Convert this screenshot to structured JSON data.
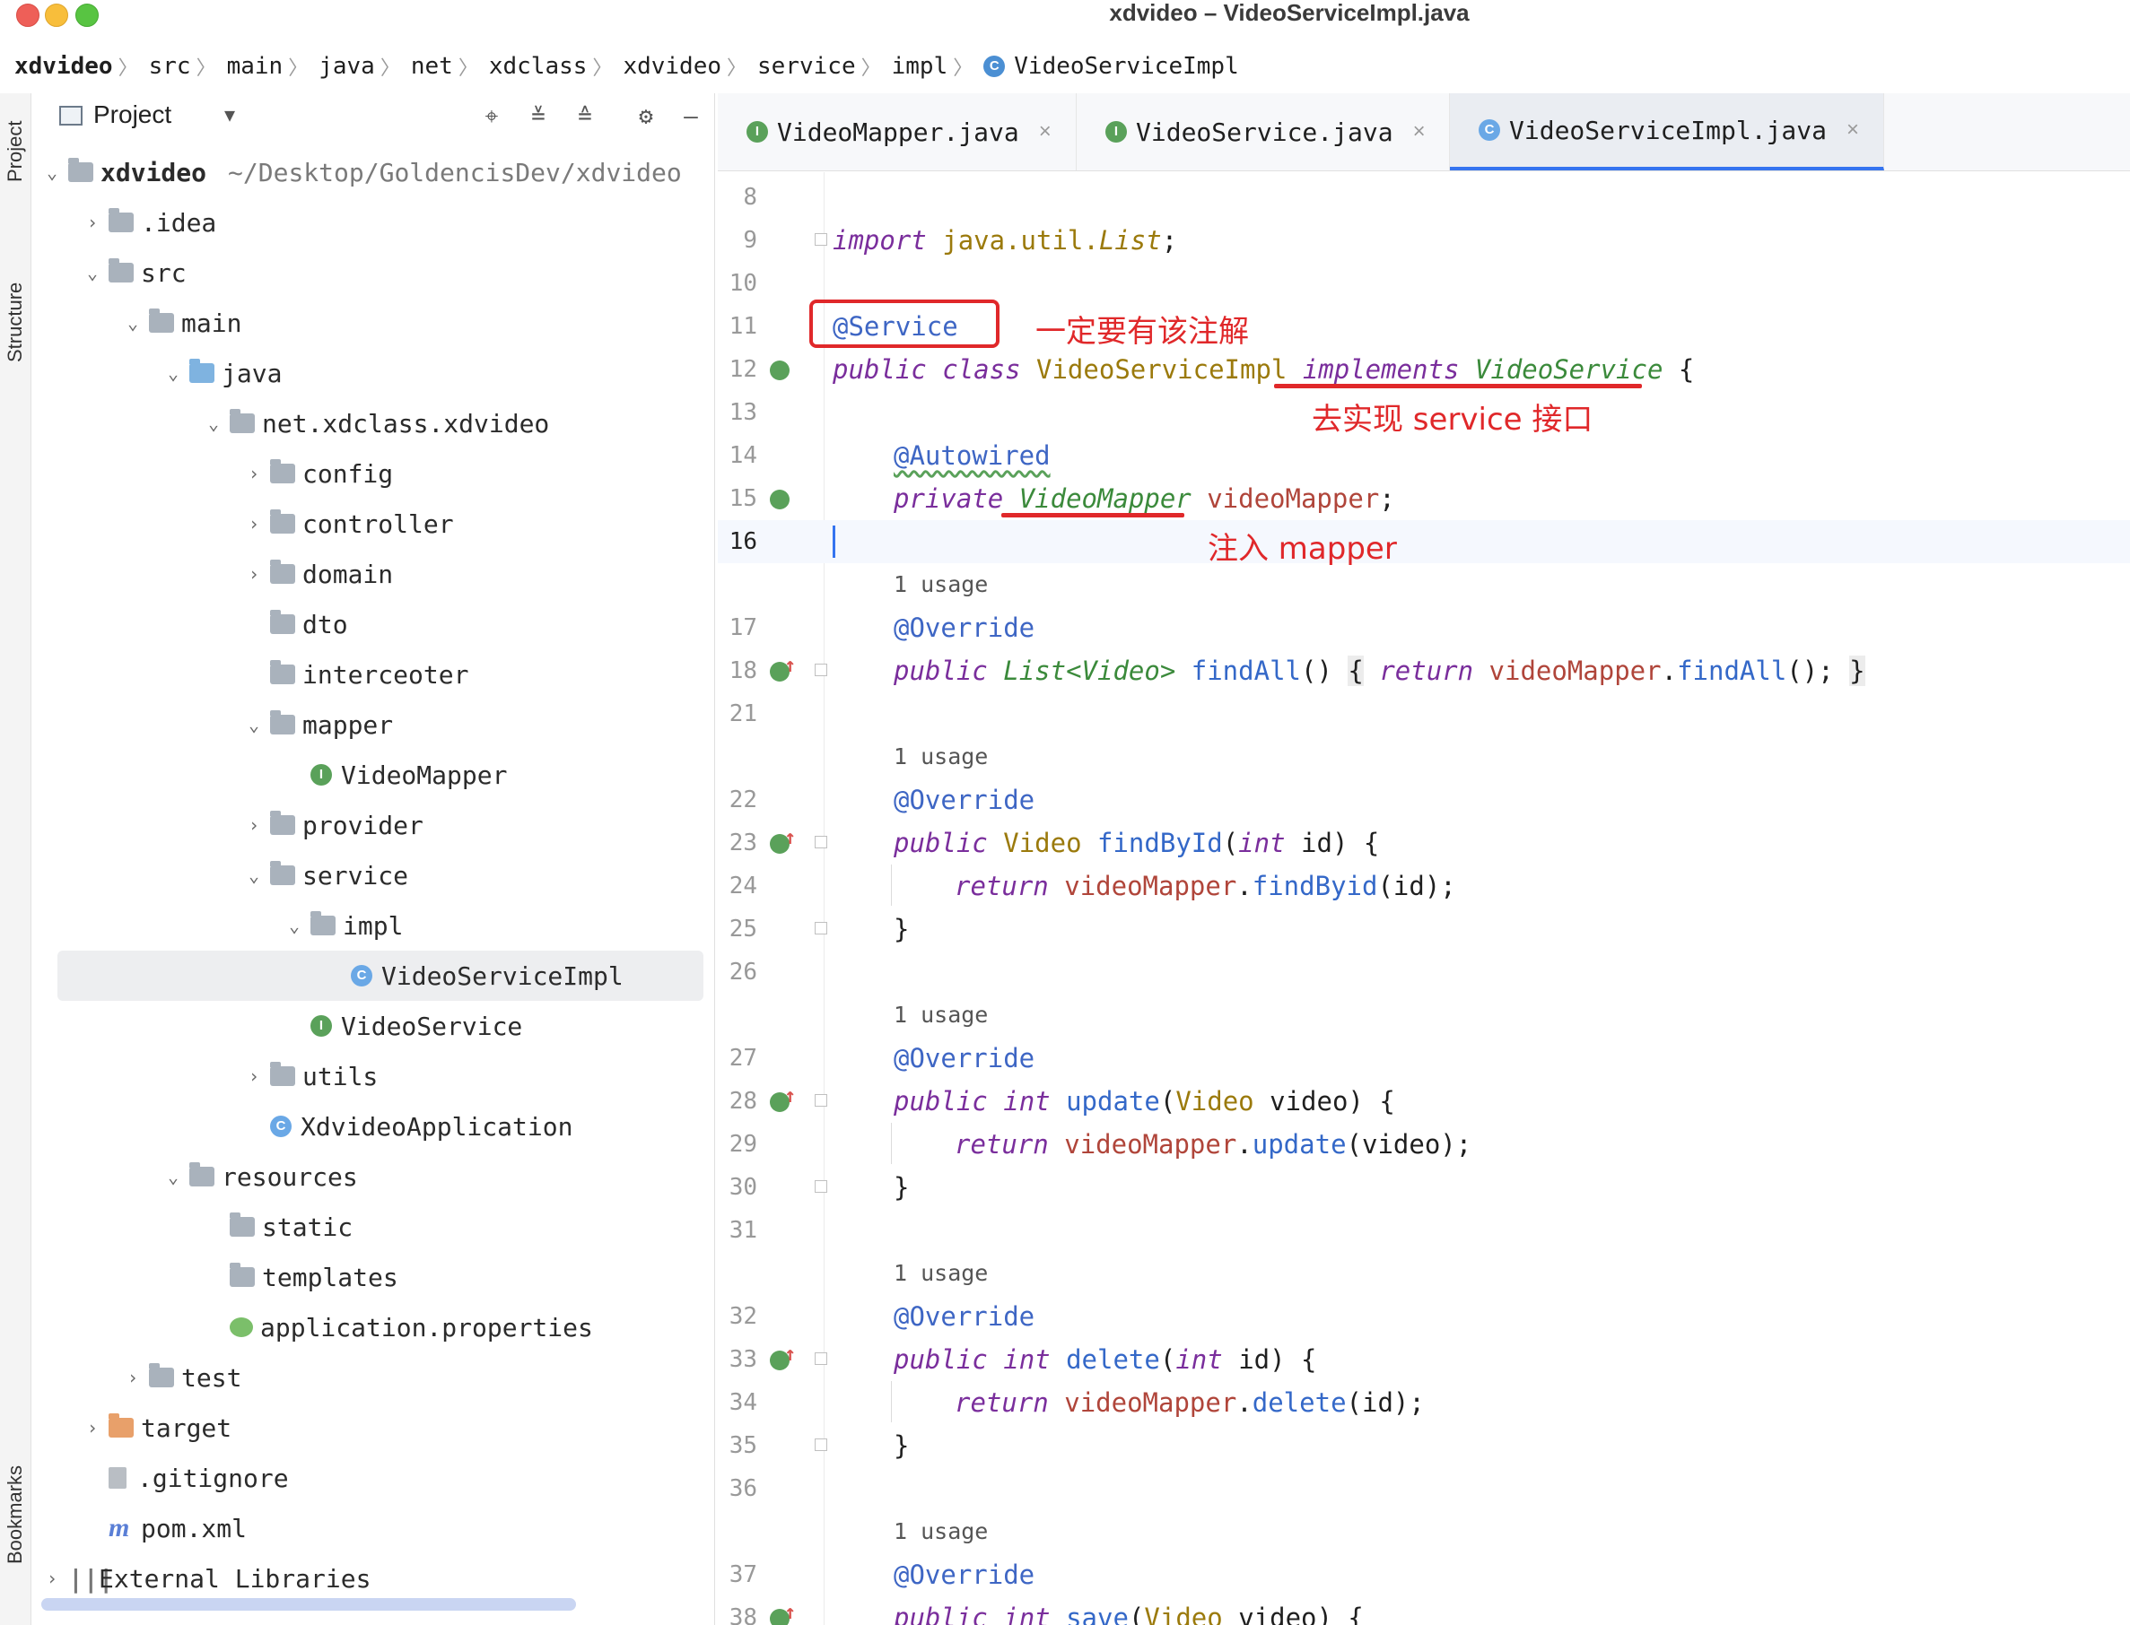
{
  "window": {
    "title": "xdvideo – VideoServiceImpl.java"
  },
  "breadcrumb": [
    "xdvideo",
    "src",
    "main",
    "java",
    "net",
    "xdclass",
    "xdvideo",
    "service",
    "impl",
    "VideoServiceImpl"
  ],
  "toolstrip": {
    "project": "Project",
    "structure": "Structure",
    "bookmarks": "Bookmarks"
  },
  "project_panel": {
    "title": "Project",
    "tree": [
      {
        "label": "xdvideo",
        "suffix": "~/Desktop/GoldencisDev/xdvideo",
        "depth": 0,
        "toggle": "open",
        "icon": "module-folder-icon"
      },
      {
        "label": ".idea",
        "depth": 1,
        "toggle": "closed",
        "icon": "folder-icon"
      },
      {
        "label": "src",
        "depth": 1,
        "toggle": "open",
        "icon": "folder-icon"
      },
      {
        "label": "main",
        "depth": 2,
        "toggle": "open",
        "icon": "folder-icon"
      },
      {
        "label": "java",
        "depth": 3,
        "toggle": "open",
        "icon": "source-folder-icon"
      },
      {
        "label": "net.xdclass.xdvideo",
        "depth": 4,
        "toggle": "open",
        "icon": "package-icon"
      },
      {
        "label": "config",
        "depth": 5,
        "toggle": "closed",
        "icon": "package-icon"
      },
      {
        "label": "controller",
        "depth": 5,
        "toggle": "closed",
        "icon": "package-icon"
      },
      {
        "label": "domain",
        "depth": 5,
        "toggle": "closed",
        "icon": "package-icon"
      },
      {
        "label": "dto",
        "depth": 5,
        "toggle": "none",
        "icon": "package-icon"
      },
      {
        "label": "interceoter",
        "depth": 5,
        "toggle": "none",
        "icon": "package-icon"
      },
      {
        "label": "mapper",
        "depth": 5,
        "toggle": "open",
        "icon": "package-icon"
      },
      {
        "label": "VideoMapper",
        "depth": 6,
        "toggle": "none",
        "icon": "interface-icon"
      },
      {
        "label": "provider",
        "depth": 5,
        "toggle": "closed",
        "icon": "package-icon"
      },
      {
        "label": "service",
        "depth": 5,
        "toggle": "open",
        "icon": "package-icon"
      },
      {
        "label": "impl",
        "depth": 6,
        "toggle": "open",
        "icon": "package-icon"
      },
      {
        "label": "VideoServiceImpl",
        "depth": 7,
        "toggle": "none",
        "icon": "class-icon",
        "selected": true
      },
      {
        "label": "VideoService",
        "depth": 6,
        "toggle": "none",
        "icon": "interface-icon"
      },
      {
        "label": "utils",
        "depth": 5,
        "toggle": "closed",
        "icon": "package-icon"
      },
      {
        "label": "XdvideoApplication",
        "depth": 5,
        "toggle": "none",
        "icon": "spring-class-icon"
      },
      {
        "label": "resources",
        "depth": 3,
        "toggle": "open",
        "icon": "resources-folder-icon"
      },
      {
        "label": "static",
        "depth": 4,
        "toggle": "none",
        "icon": "folder-icon"
      },
      {
        "label": "templates",
        "depth": 4,
        "toggle": "none",
        "icon": "folder-icon"
      },
      {
        "label": "application.properties",
        "depth": 4,
        "toggle": "none",
        "icon": "properties-file-icon"
      },
      {
        "label": "test",
        "depth": 2,
        "toggle": "closed",
        "icon": "folder-icon"
      },
      {
        "label": "target",
        "depth": 1,
        "toggle": "closed",
        "icon": "excluded-folder-icon"
      },
      {
        "label": ".gitignore",
        "depth": 1,
        "toggle": "none",
        "icon": "gitignore-file-icon"
      },
      {
        "label": "pom.xml",
        "depth": 1,
        "toggle": "none",
        "icon": "maven-file-icon"
      },
      {
        "label": "External Libraries",
        "depth": 0,
        "toggle": "closed",
        "icon": "libraries-icon"
      }
    ]
  },
  "editor_tabs": [
    {
      "label": "VideoMapper.java",
      "icon": "interface-icon",
      "active": false
    },
    {
      "label": "VideoService.java",
      "icon": "interface-icon",
      "active": false
    },
    {
      "label": "VideoServiceImpl.java",
      "icon": "class-icon",
      "active": true
    }
  ],
  "editor": {
    "usage_label": "1 usage",
    "lines": {
      "l8": "8",
      "l9": "9",
      "l10": "10",
      "l11": "11",
      "l12": "12",
      "l13": "13",
      "l14": "14",
      "l15": "15",
      "l16": "16",
      "l17": "17",
      "l18": "18",
      "l21": "21",
      "l22": "22",
      "l23": "23",
      "l24": "24",
      "l25": "25",
      "l26": "26",
      "l27": "27",
      "l28": "28",
      "l29": "29",
      "l30": "30",
      "l31": "31",
      "l32": "32",
      "l33": "33",
      "l34": "34",
      "l35": "35",
      "l36": "36",
      "l37": "37",
      "l38": "38"
    },
    "tok": {
      "import": "import",
      "import_path": "java.util.",
      "list_cls": "List",
      "semi": ";",
      "service_ann": "@Service",
      "public": "public",
      "class": "class",
      "impl_name": "VideoServiceImpl",
      "implements": "implements",
      "video_service": "VideoService",
      "open_brace": "{",
      "close_brace": "}",
      "autowired": "@Autowired",
      "private": "private",
      "video_mapper_type": "VideoMapper",
      "video_mapper_field": "videoMapper",
      "override": "@Override",
      "list_video": "List<Video>",
      "find_all": "findAll",
      "parens": "()",
      "return": "return",
      "dot": ".",
      "call_end": "();",
      "video": "Video",
      "find_by_id": "findById",
      "int": "int",
      "id_param": "id",
      "find_byid": "findByid",
      "id_call": "(id);",
      "update": "update",
      "video_param": "video",
      "video_call": "(video);",
      "delete": "delete",
      "save": "save",
      "open_paren": "(",
      "param_close_brace": ") {"
    }
  },
  "annotations": {
    "note_service": "一定要有该注解",
    "note_implements": "去实现 service 接口",
    "note_mapper": "注入 mapper",
    "color": "#e0282a"
  }
}
